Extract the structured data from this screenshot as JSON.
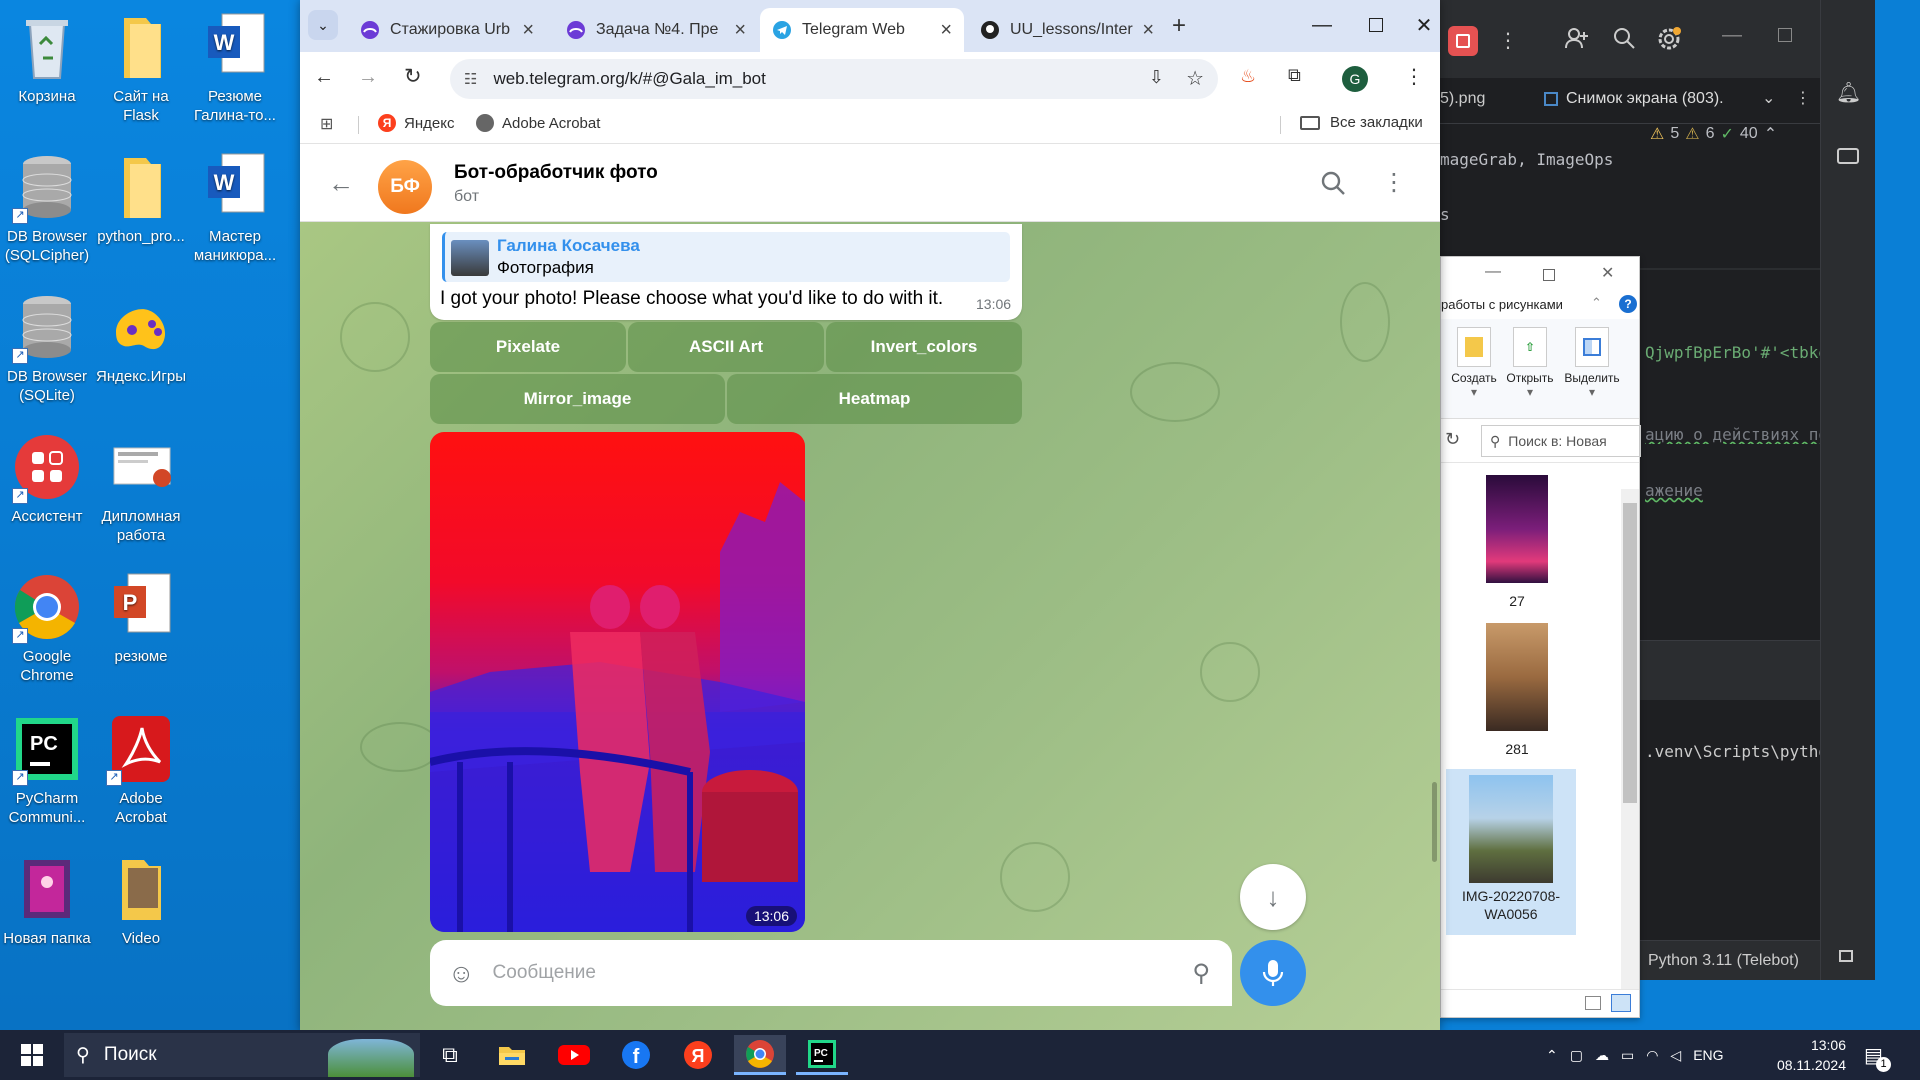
{
  "desktop": {
    "icons": [
      {
        "label": "Корзина"
      },
      {
        "label": "Сайт на Flask"
      },
      {
        "label": "Резюме Галина-то..."
      },
      {
        "label": "DB Browser (SQLCipher)"
      },
      {
        "label": "python_pro..."
      },
      {
        "label": "Мастер маникюра..."
      },
      {
        "label": "DB Browser (SQLite)"
      },
      {
        "label": "Яндекс.Игры"
      },
      {
        "label": "Ассистент"
      },
      {
        "label": "Дипломная работа"
      },
      {
        "label": "Google Chrome"
      },
      {
        "label": "резюме"
      },
      {
        "label": "PyCharm Communi..."
      },
      {
        "label": "Adobe Acrobat"
      },
      {
        "label": "Новая папка"
      },
      {
        "label": "Video"
      }
    ]
  },
  "browser": {
    "tabs": [
      {
        "title": "Стажировка Urb"
      },
      {
        "title": "Задача №4. Пре"
      },
      {
        "title": "Telegram Web"
      },
      {
        "title": "UU_lessons/Inter"
      }
    ],
    "url": "web.telegram.org/k/#@Gala_im_bot",
    "bookmarks": [
      {
        "label": "Яндекс"
      },
      {
        "label": "Adobe Acrobat"
      }
    ],
    "all_bookmarks": "Все закладки",
    "profile_initial": "G"
  },
  "chat": {
    "avatar": "БФ",
    "title": "Бот-обработчик фото",
    "subtitle": "бот",
    "reply_author": "Галина Косачева",
    "reply_text": "Фотография",
    "message": "I got your photo! Please choose what you'd like to do with it.",
    "message_time": "13:06",
    "buttons_row1": [
      "Pixelate",
      "ASCII Art",
      "Invert_colors"
    ],
    "buttons_row2": [
      "Mirror_image",
      "Heatmap"
    ],
    "photo_time": "13:06",
    "composer_placeholder": "Сообщение"
  },
  "pycharm": {
    "tab_left": "5).png",
    "tab_right": "Снимок экрана (803).",
    "warn1": "5",
    "warn2": "6",
    "ok": "40",
    "code_lines": [
      "mageGrab, ImageOps",
      "s",
      "QjwpfBpErBo'#'<tbke",
      "ацию о действиях по",
      "ажение",
      ".venv\\Scripts\\pytho"
    ],
    "interpreter": "Python 3.11 (Telebot)"
  },
  "explorer": {
    "ribbon_title": "работы с рисунками",
    "actions": [
      "Создать",
      "Открыть",
      "Выделить"
    ],
    "search_placeholder": "Поиск в: Новая",
    "files": [
      {
        "name": "27"
      },
      {
        "name": "281"
      },
      {
        "name": "IMG-20220708-WA0056"
      }
    ]
  },
  "taskbar": {
    "search": "Поиск",
    "lang": "ENG",
    "time": "13:06",
    "date": "08.11.2024",
    "notifications": "1"
  }
}
